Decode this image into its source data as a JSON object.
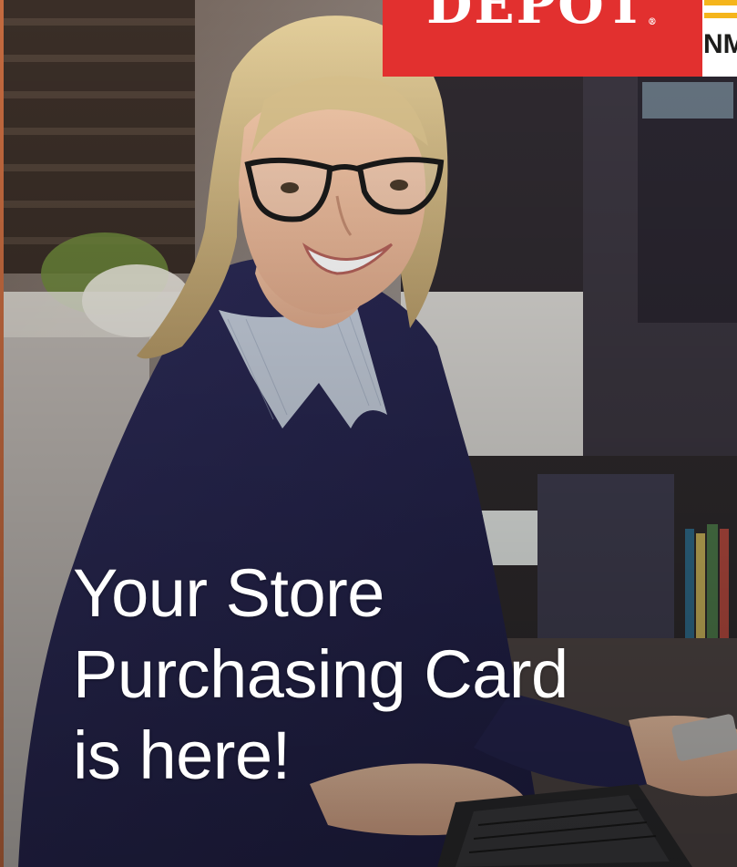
{
  "logo": {
    "primary_text": "DEPOT",
    "registered_mark": "®",
    "secondary_text": "NM",
    "primary_color": "#e2302f",
    "accent_color": "#f5b51c"
  },
  "headline": {
    "line1": "Your Store",
    "line2": "Purchasing Card",
    "line3": "is here!"
  },
  "photo": {
    "subject": "smiling-woman-with-glasses-at-laptop-holding-card"
  }
}
